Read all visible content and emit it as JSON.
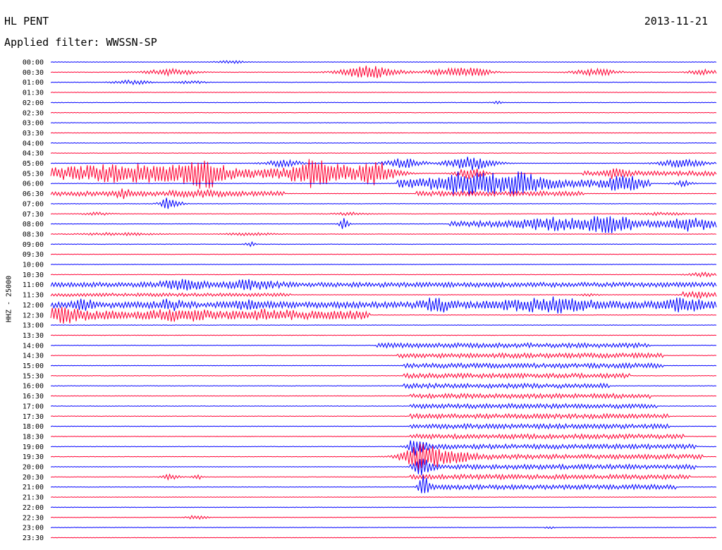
{
  "header": {
    "station": "HL PENT",
    "date": "2013-11-21",
    "filter": "Applied filter: WWSSN-SP"
  },
  "colors": {
    "odd": "#0000ff",
    "even": "#ff0033",
    "text": "#000000"
  },
  "chart_data": {
    "type": "line",
    "ylabel": "HHZ - 25000",
    "row_labels": [
      "00:00",
      "00:30",
      "01:00",
      "01:30",
      "02:00",
      "02:30",
      "03:00",
      "03:30",
      "04:00",
      "04:30",
      "05:00",
      "05:30",
      "06:00",
      "06:30",
      "07:00",
      "07:30",
      "08:00",
      "08:30",
      "09:00",
      "09:30",
      "10:00",
      "10:30",
      "11:00",
      "11:30",
      "12:00",
      "12:30",
      "13:00",
      "13:30",
      "14:00",
      "14:30",
      "15:00",
      "15:30",
      "16:00",
      "16:30",
      "17:00",
      "17:30",
      "18:00",
      "18:30",
      "19:00",
      "19:30",
      "20:00",
      "20:30",
      "21:00",
      "21:30",
      "22:00",
      "22:30",
      "23:00",
      "23:30"
    ],
    "trace_duration_min": 30,
    "noise_level": 0.4,
    "events": [
      {
        "row": 0,
        "t": 0.27,
        "w": 0.03,
        "a": 2
      },
      {
        "row": 1,
        "t": 0.18,
        "w": 0.05,
        "a": 5
      },
      {
        "row": 1,
        "t": 0.48,
        "w": 0.06,
        "a": 9
      },
      {
        "row": 1,
        "t": 0.6,
        "w": 0.05,
        "a": 5
      },
      {
        "row": 1,
        "t": 0.64,
        "w": 0.04,
        "a": 4
      },
      {
        "row": 1,
        "t": 0.82,
        "w": 0.05,
        "a": 5
      },
      {
        "row": 1,
        "t": 0.98,
        "w": 0.03,
        "a": 4
      },
      {
        "row": 2,
        "t": 0.12,
        "w": 0.04,
        "a": 3
      },
      {
        "row": 2,
        "t": 0.21,
        "w": 0.03,
        "a": 2
      },
      {
        "row": 4,
        "t": 0.67,
        "w": 0.01,
        "a": 2
      },
      {
        "row": 10,
        "t": 0.35,
        "w": 0.04,
        "a": 5
      },
      {
        "row": 10,
        "t": 0.53,
        "w": 0.04,
        "a": 7
      },
      {
        "row": 10,
        "t": 0.63,
        "w": 0.05,
        "a": 10
      },
      {
        "row": 10,
        "t": 0.95,
        "w": 0.05,
        "a": 6
      },
      {
        "row": 11,
        "t": 0.12,
        "w": 0.15,
        "a": 8
      },
      {
        "row": 11,
        "t": 0.23,
        "w": 0.04,
        "a": 14
      },
      {
        "row": 11,
        "t": 0.4,
        "w": 0.05,
        "a": 16
      },
      {
        "row": 11,
        "t": 0.49,
        "w": 0.05,
        "a": 11
      },
      {
        "row": 11,
        "t": 0.63,
        "w": 0.03,
        "a": 8
      },
      {
        "row": 11,
        "t": 0.85,
        "w": 0.02,
        "a": 6
      },
      {
        "row": 12,
        "t": 0.62,
        "w": 0.07,
        "a": 12
      },
      {
        "row": 12,
        "t": 0.7,
        "w": 0.06,
        "a": 11
      },
      {
        "row": 12,
        "t": 0.86,
        "w": 0.03,
        "a": 9
      },
      {
        "row": 12,
        "t": 0.95,
        "w": 0.02,
        "a": 4
      },
      {
        "row": 13,
        "t": 0.11,
        "w": 0.02,
        "a": 5
      },
      {
        "row": 13,
        "t": 0.22,
        "w": 0.05,
        "a": 3
      },
      {
        "row": 14,
        "t": 0.18,
        "w": 0.02,
        "a": 10
      },
      {
        "row": 15,
        "t": 0.07,
        "w": 0.03,
        "a": 2
      },
      {
        "row": 15,
        "t": 0.45,
        "w": 0.04,
        "a": 2
      },
      {
        "row": 15,
        "t": 0.92,
        "w": 0.05,
        "a": 2
      },
      {
        "row": 16,
        "t": 0.44,
        "w": 0.01,
        "a": 8
      },
      {
        "row": 16,
        "t": 0.75,
        "w": 0.06,
        "a": 6
      },
      {
        "row": 16,
        "t": 0.84,
        "w": 0.05,
        "a": 10
      },
      {
        "row": 16,
        "t": 0.96,
        "w": 0.04,
        "a": 7
      },
      {
        "row": 17,
        "t": 0.1,
        "w": 0.08,
        "a": 2
      },
      {
        "row": 17,
        "t": 0.3,
        "w": 0.05,
        "a": 2
      },
      {
        "row": 18,
        "t": 0.3,
        "w": 0.01,
        "a": 3
      },
      {
        "row": 21,
        "t": 0.98,
        "w": 0.03,
        "a": 3
      },
      {
        "row": 22,
        "t": 0.2,
        "w": 0.05,
        "a": 5
      },
      {
        "row": 22,
        "t": 0.3,
        "w": 0.05,
        "a": 5
      },
      {
        "row": 23,
        "t": 0.81,
        "w": 0.02,
        "a": 2
      },
      {
        "row": 23,
        "t": 0.97,
        "w": 0.03,
        "a": 2
      },
      {
        "row": 24,
        "t": 0.05,
        "w": 0.02,
        "a": 5
      },
      {
        "row": 24,
        "t": 0.18,
        "w": 0.03,
        "a": 5
      },
      {
        "row": 24,
        "t": 0.3,
        "w": 0.03,
        "a": 5
      },
      {
        "row": 24,
        "t": 0.58,
        "w": 0.03,
        "a": 8
      },
      {
        "row": 24,
        "t": 0.75,
        "w": 0.1,
        "a": 8
      },
      {
        "row": 24,
        "t": 0.95,
        "w": 0.05,
        "a": 7
      },
      {
        "row": 25,
        "t": 0.02,
        "w": 0.04,
        "a": 6
      },
      {
        "row": 25,
        "t": 0.2,
        "w": 0.06,
        "a": 4
      },
      {
        "row": 25,
        "t": 0.33,
        "w": 0.04,
        "a": 3
      },
      {
        "row": 38,
        "t": 0.55,
        "w": 0.02,
        "a": 10
      },
      {
        "row": 39,
        "t": 0.555,
        "w": 0.04,
        "a": 16
      },
      {
        "row": 39,
        "t": 0.6,
        "w": 0.05,
        "a": 6
      },
      {
        "row": 40,
        "t": 0.56,
        "w": 0.02,
        "a": 10
      },
      {
        "row": 41,
        "t": 0.18,
        "w": 0.02,
        "a": 4
      },
      {
        "row": 41,
        "t": 0.22,
        "w": 0.01,
        "a": 4
      },
      {
        "row": 42,
        "t": 0.56,
        "w": 0.01,
        "a": 16
      },
      {
        "row": 45,
        "t": 0.22,
        "w": 0.02,
        "a": 3
      },
      {
        "row": 46,
        "t": 0.75,
        "w": 0.01,
        "a": 2
      }
    ],
    "bands": [
      {
        "row": 11,
        "t0": 0.0,
        "t1": 0.5,
        "a": 6
      },
      {
        "row": 11,
        "t0": 0.8,
        "t1": 1.0,
        "a": 3
      },
      {
        "row": 12,
        "t0": 0.52,
        "t1": 0.9,
        "a": 5
      },
      {
        "row": 13,
        "t0": 0.0,
        "t1": 0.35,
        "a": 3
      },
      {
        "row": 13,
        "t0": 0.55,
        "t1": 0.8,
        "a": 3
      },
      {
        "row": 16,
        "t0": 0.6,
        "t1": 1.0,
        "a": 4
      },
      {
        "row": 22,
        "t0": 0.0,
        "t1": 1.0,
        "a": 3
      },
      {
        "row": 23,
        "t0": 0.0,
        "t1": 0.36,
        "a": 2
      },
      {
        "row": 23,
        "t0": 0.95,
        "t1": 1.0,
        "a": 3
      },
      {
        "row": 24,
        "t0": 0.0,
        "t1": 1.0,
        "a": 4
      },
      {
        "row": 25,
        "t0": 0.0,
        "t1": 0.48,
        "a": 6
      },
      {
        "row": 28,
        "t0": 0.49,
        "t1": 0.9,
        "a": 3
      },
      {
        "row": 29,
        "t0": 0.52,
        "t1": 0.92,
        "a": 3
      },
      {
        "row": 30,
        "t0": 0.53,
        "t1": 0.92,
        "a": 3
      },
      {
        "row": 31,
        "t0": 0.53,
        "t1": 0.87,
        "a": 3
      },
      {
        "row": 32,
        "t0": 0.53,
        "t1": 0.84,
        "a": 3
      },
      {
        "row": 33,
        "t0": 0.54,
        "t1": 0.9,
        "a": 3
      },
      {
        "row": 34,
        "t0": 0.54,
        "t1": 0.91,
        "a": 3
      },
      {
        "row": 35,
        "t0": 0.54,
        "t1": 0.93,
        "a": 3
      },
      {
        "row": 36,
        "t0": 0.54,
        "t1": 0.93,
        "a": 3
      },
      {
        "row": 37,
        "t0": 0.54,
        "t1": 0.95,
        "a": 3
      },
      {
        "row": 38,
        "t0": 0.54,
        "t1": 0.97,
        "a": 3
      },
      {
        "row": 39,
        "t0": 0.54,
        "t1": 0.98,
        "a": 3
      },
      {
        "row": 40,
        "t0": 0.54,
        "t1": 0.97,
        "a": 3
      },
      {
        "row": 41,
        "t0": 0.54,
        "t1": 0.96,
        "a": 3
      },
      {
        "row": 42,
        "t0": 0.55,
        "t1": 0.94,
        "a": 3
      }
    ]
  }
}
